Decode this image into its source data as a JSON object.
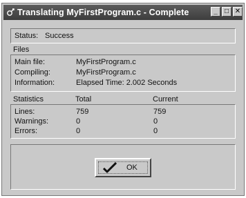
{
  "window": {
    "title": "Translating  MyFirstProgram.c - Complete",
    "controls": {
      "minimize": "_",
      "maximize": "□",
      "close": "✕"
    }
  },
  "status": {
    "label": "Status:",
    "value": "Success"
  },
  "files": {
    "header": "Files",
    "rows": [
      {
        "label": "Main file:",
        "value": "MyFirstProgram.c"
      },
      {
        "label": "Compiling:",
        "value": "MyFirstProgram.c"
      },
      {
        "label": "Information:",
        "value": "Elapsed Time: 2.002 Seconds"
      }
    ]
  },
  "statistics": {
    "header": "Statistics",
    "col_total": "Total",
    "col_current": "Current",
    "rows": [
      {
        "label": "Lines:",
        "total": "759",
        "current": "759"
      },
      {
        "label": "Warnings:",
        "total": "0",
        "current": "0"
      },
      {
        "label": "Errors:",
        "total": "0",
        "current": "0"
      }
    ]
  },
  "ok_button": {
    "label": "OK",
    "icon": "checkmark-icon"
  }
}
